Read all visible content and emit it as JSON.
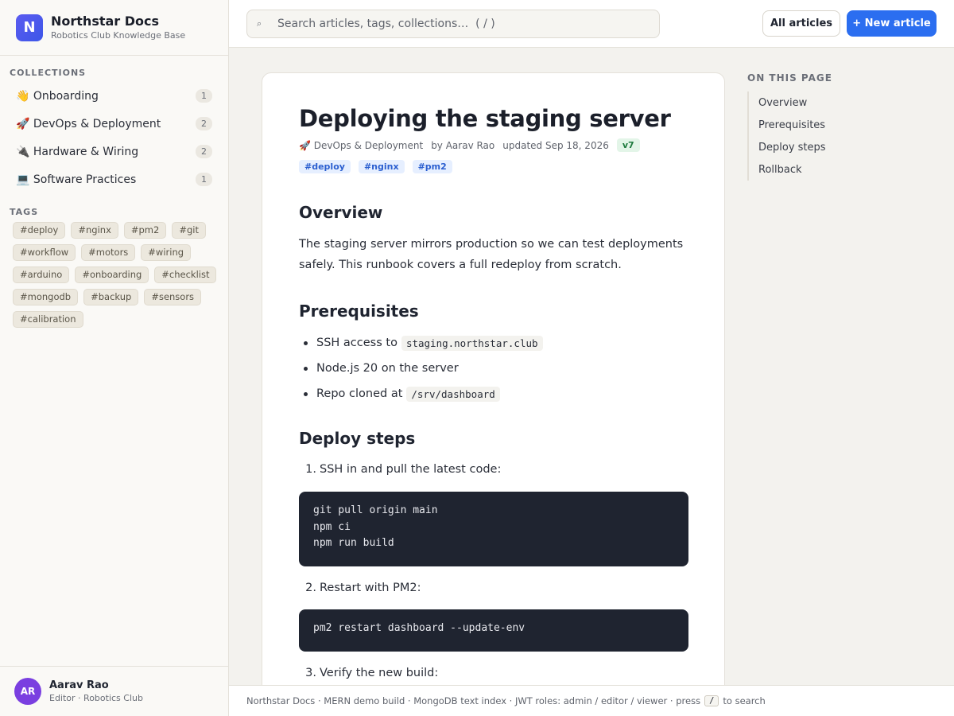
{
  "brand": {
    "logo_letter": "N",
    "title": "Northstar Docs",
    "subtitle": "Robotics Club Knowledge Base"
  },
  "sidebar": {
    "collections_label": "COLLECTIONS",
    "collections": [
      {
        "label": "👋 Onboarding",
        "count": "1"
      },
      {
        "label": "🚀 DevOps & Deployment",
        "count": "2"
      },
      {
        "label": "🔌 Hardware & Wiring",
        "count": "2"
      },
      {
        "label": "💻 Software Practices",
        "count": "1"
      }
    ],
    "tags_label": "TAGS",
    "tags": [
      "#deploy",
      "#nginx",
      "#pm2",
      "#git",
      "#workflow",
      "#motors",
      "#wiring",
      "#arduino",
      "#onboarding",
      "#checklist",
      "#mongodb",
      "#backup",
      "#sensors",
      "#calibration"
    ]
  },
  "user": {
    "initials": "AR",
    "name": "Aarav Rao",
    "role": "Editor · Robotics Club"
  },
  "topbar": {
    "search_placeholder": "Search articles, tags, collections…  ( / )",
    "all_articles_label": "All articles",
    "new_article_label": "+ New article"
  },
  "article": {
    "title": "Deploying the staging server",
    "meta": {
      "collection": "🚀 DevOps & Deployment",
      "author": "by Aarav Rao",
      "updated": "updated Sep 18, 2026",
      "version": "v7",
      "tags": [
        "#deploy",
        "#nginx",
        "#pm2"
      ]
    },
    "overview_heading": "Overview",
    "overview_text": "The staging server mirrors production so we can test deployments safely. This runbook covers a full redeploy from scratch.",
    "prereq_heading": "Prerequisites",
    "prereq": [
      {
        "text": "SSH access to",
        "code": "staging.northstar.club"
      },
      {
        "text": "Node.js 20 on the server",
        "code": ""
      },
      {
        "text": "Repo cloned at",
        "code": "/srv/dashboard"
      }
    ],
    "deploy_heading": "Deploy steps",
    "steps": [
      {
        "num": "1.",
        "text": "SSH in and pull the latest code:",
        "code": "git pull origin main\nnpm ci\nnpm run build"
      },
      {
        "num": "2.",
        "text": "Restart with PM2:",
        "code": "pm2 restart dashboard --update-env"
      },
      {
        "num": "3.",
        "text": "Verify the new build:",
        "code": ""
      }
    ]
  },
  "toc": {
    "label": "ON THIS PAGE",
    "items": [
      "Overview",
      "Prerequisites",
      "Deploy steps",
      "Rollback"
    ]
  },
  "footer": {
    "text": "Northstar Docs · MERN demo build · MongoDB text index · JWT roles: admin / editor / viewer  ·  press",
    "key": "/",
    "suffix": "to search"
  }
}
